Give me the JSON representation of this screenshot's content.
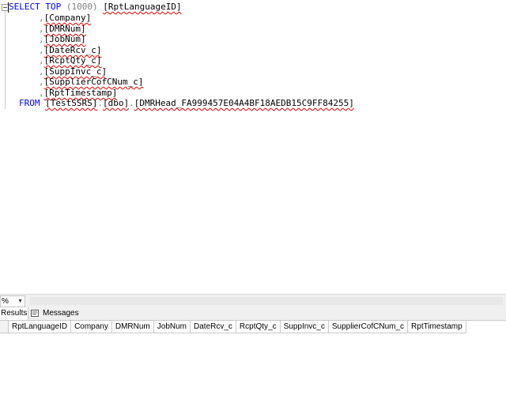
{
  "editor": {
    "line1": {
      "select": "SELECT",
      "top": "TOP",
      "count": "(1000)",
      "first_col": "[RptLanguageID]"
    },
    "columns": [
      {
        "comma": ",",
        "name": "[Company]"
      },
      {
        "comma": ",",
        "name": "[DMRNum]"
      },
      {
        "comma": ",",
        "name": "[JobNum]"
      },
      {
        "comma": ",",
        "name": "[DateRcv_c]"
      },
      {
        "comma": ",",
        "name": "[RcptQty_c]"
      },
      {
        "comma": ",",
        "name": "[SuppInvc_c]"
      },
      {
        "comma": ",",
        "name": "[SupplierCofCNum_c]"
      },
      {
        "comma": ",",
        "name": "[RptTimestamp]"
      }
    ],
    "from_line": {
      "from": "FROM",
      "db": "[TestSSRS]",
      "dot1": ".",
      "schema": "[dbo]",
      "dot2": ".",
      "table": "[DMRHead_FA999457E04A4BF18AEDB15C9FF84255]"
    }
  },
  "zoom": {
    "value": "%",
    "arrow": "▼"
  },
  "tabs": {
    "results": "Results",
    "messages": "Messages"
  },
  "grid": {
    "columns": [
      "RptLanguageID",
      "Company",
      "DMRNum",
      "JobNum",
      "DateRcv_c",
      "RcptQty_c",
      "SuppInvc_c",
      "SupplierCofCNum_c",
      "RptTimestamp"
    ]
  }
}
